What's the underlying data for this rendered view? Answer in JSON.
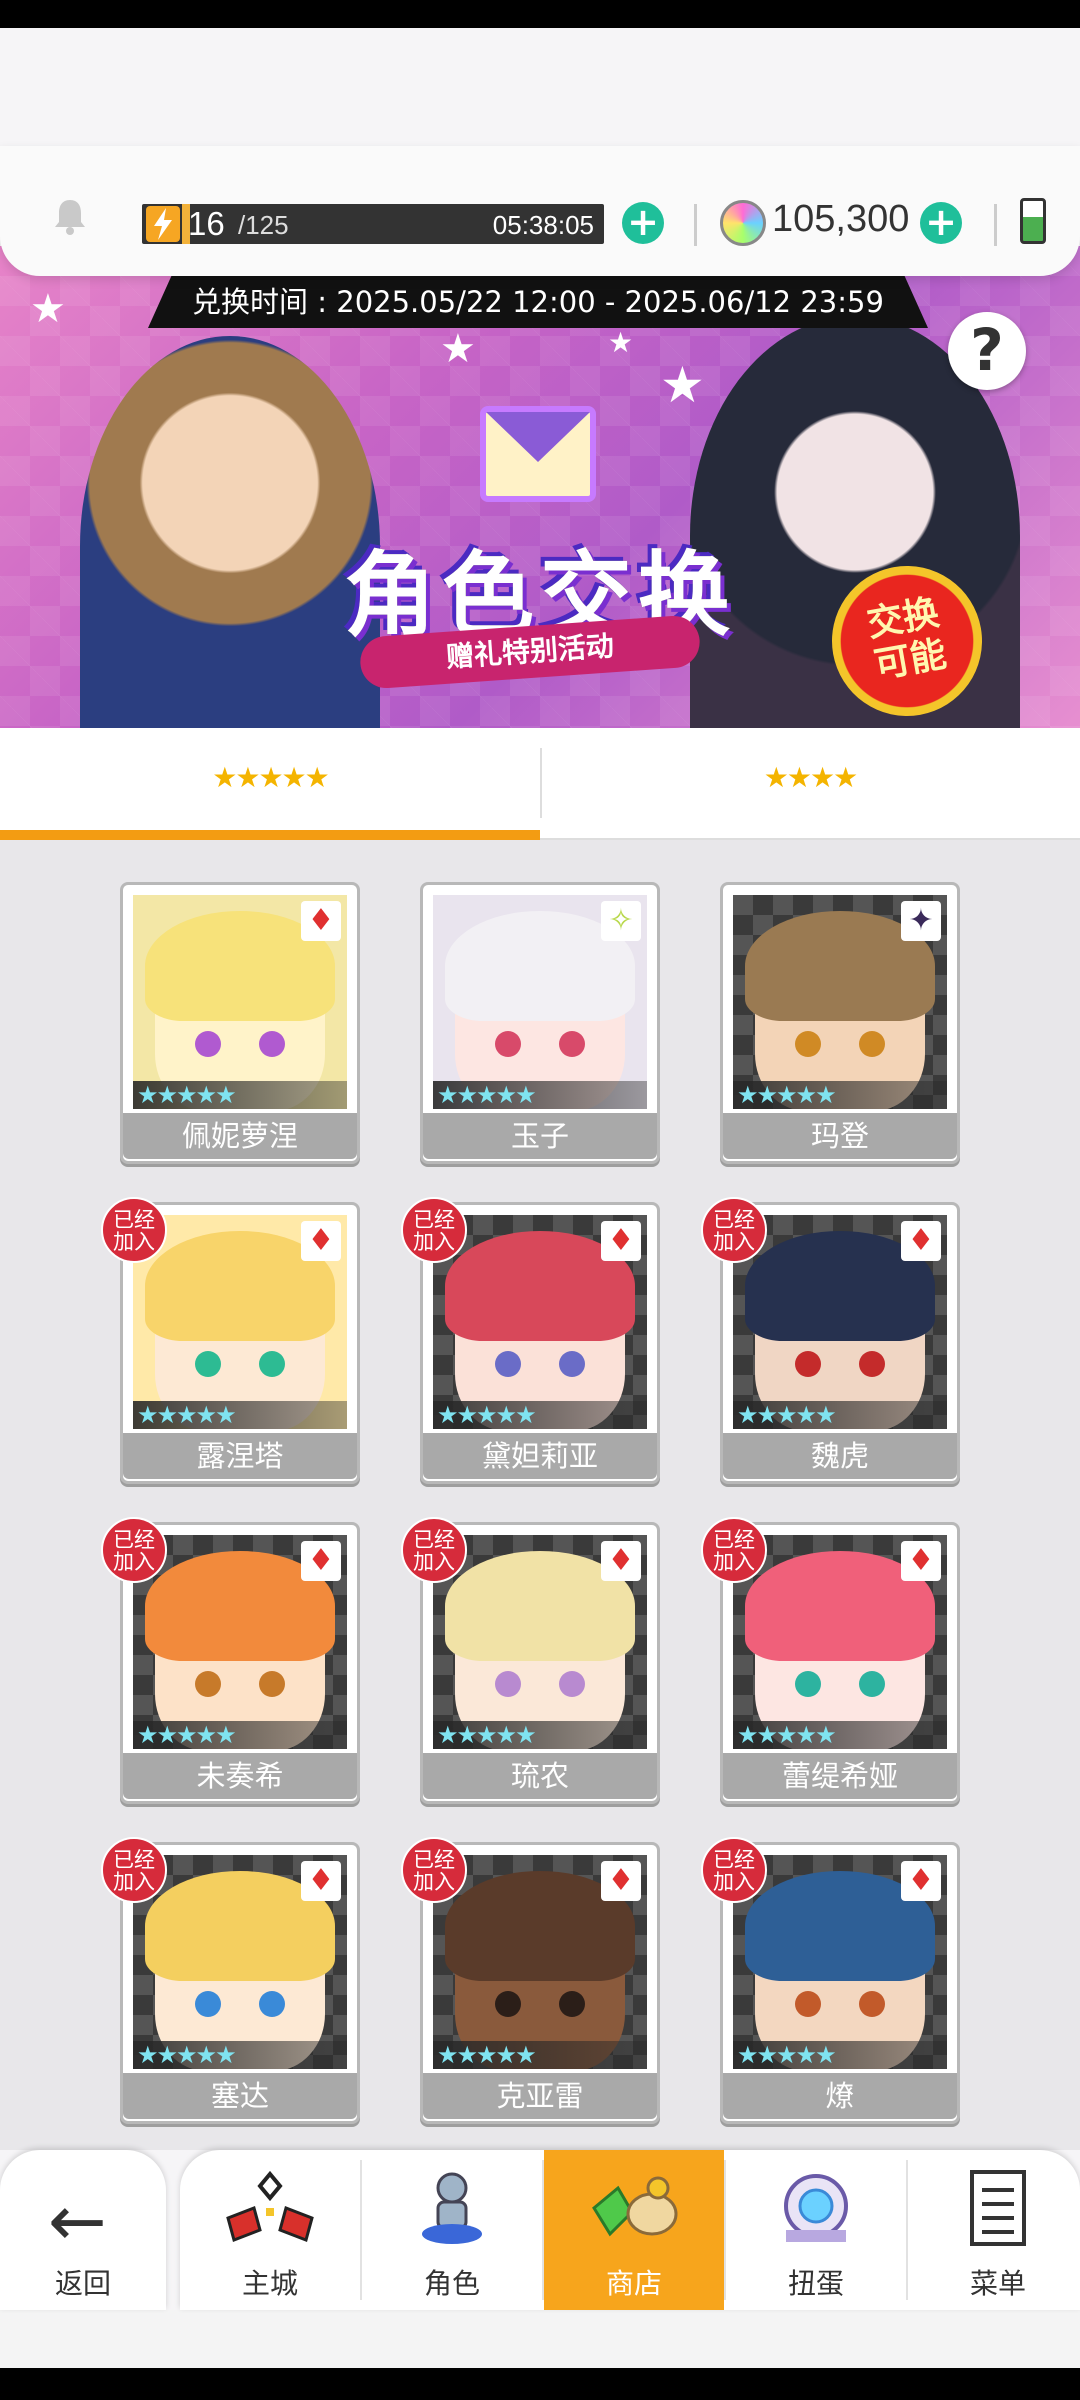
{
  "status": {
    "stamina_current": "16",
    "stamina_max": "/125",
    "stamina_timer": "05:38:05",
    "gems": "105,300"
  },
  "banner": {
    "period": "兑换时间 : 2025.05/22 12:00 - 2025.06/12 23:59",
    "title": "角色交换",
    "subtitle": "赠礼特别活动",
    "badge": "交换\n可能",
    "help": "?"
  },
  "tabs": [
    {
      "label": "★★★★★",
      "active": true
    },
    {
      "label": "★★★★",
      "active": false
    }
  ],
  "joined_label": "已经\n加入",
  "characters": [
    {
      "name": "佩妮萝涅",
      "joined": false,
      "attr": "♦",
      "hair": "#f7e27a",
      "skin": "#fff3c9",
      "eye": "#b05ad0",
      "bg": "#f3e7a6"
    },
    {
      "name": "玉子",
      "joined": false,
      "attr": "✧",
      "hair": "#f2f0f4",
      "skin": "#fde6e2",
      "eye": "#d84a6a",
      "bg": "#e9e4ee"
    },
    {
      "name": "玛登",
      "joined": false,
      "attr": "✦",
      "hair": "#9a7a52",
      "skin": "#f3d4b7",
      "eye": "#d08a25",
      "bg": ""
    },
    {
      "name": "露涅塔",
      "joined": true,
      "attr": "♦",
      "hair": "#f8d46a",
      "skin": "#fde9d4",
      "eye": "#2dbb93",
      "bg": "#ffe9a8"
    },
    {
      "name": "黛妲莉亚",
      "joined": true,
      "attr": "♦",
      "hair": "#d8485a",
      "skin": "#fbe1d8",
      "eye": "#6a6cc7",
      "bg": ""
    },
    {
      "name": "魏虎",
      "joined": true,
      "attr": "♦",
      "hair": "#26314f",
      "skin": "#f0d6c4",
      "eye": "#c42b2b",
      "bg": ""
    },
    {
      "name": "未奏希",
      "joined": true,
      "attr": "♦",
      "hair": "#f28a3c",
      "skin": "#fde2c8",
      "eye": "#c77a2a",
      "bg": ""
    },
    {
      "name": "琉农",
      "joined": true,
      "attr": "♦",
      "hair": "#f1e2a6",
      "skin": "#fbe8d8",
      "eye": "#b88ad0",
      "bg": ""
    },
    {
      "name": "蕾缇希娅",
      "joined": true,
      "attr": "♦",
      "hair": "#f0607a",
      "skin": "#fde6e2",
      "eye": "#2db3a0",
      "bg": ""
    },
    {
      "name": "塞达",
      "joined": true,
      "attr": "♦",
      "hair": "#f4cf5f",
      "skin": "#fde9d4",
      "eye": "#3a8ad8",
      "bg": ""
    },
    {
      "name": "克亚雷",
      "joined": true,
      "attr": "♦",
      "hair": "#5a3b2a",
      "skin": "#8a5a3c",
      "eye": "#2b1e18",
      "bg": ""
    },
    {
      "name": "燎",
      "joined": true,
      "attr": "♦",
      "hair": "#2e5f96",
      "skin": "#f3d7c0",
      "eye": "#c25a2a",
      "bg": ""
    }
  ],
  "star_row": "★★★★★",
  "nav": {
    "back": "返回",
    "items": [
      {
        "label": "主城",
        "icon": "castle-icon",
        "active": false
      },
      {
        "label": "角色",
        "icon": "character-icon",
        "active": false
      },
      {
        "label": "商店",
        "icon": "shop-icon",
        "active": true
      },
      {
        "label": "扭蛋",
        "icon": "gacha-icon",
        "active": false
      },
      {
        "label": "菜单",
        "icon": "menu-icon",
        "active": false
      }
    ]
  },
  "colors": {
    "accent": "#f7a51c",
    "joined_badge": "#d62b3b",
    "plus": "#1fbf9a"
  }
}
